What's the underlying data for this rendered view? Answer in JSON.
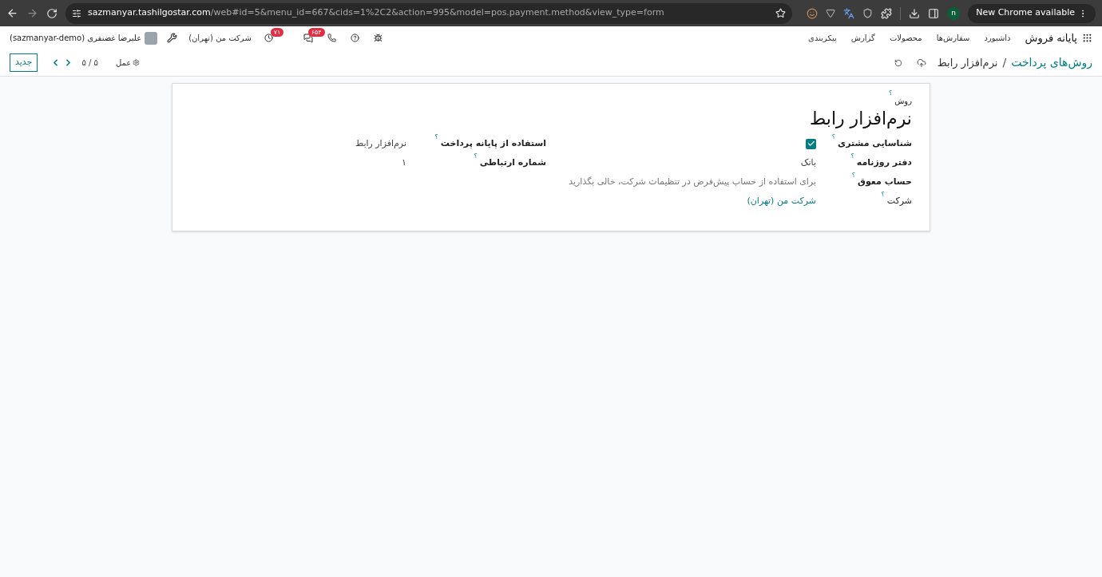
{
  "browser": {
    "url_host": "sazmanyar.tashilgostar.com",
    "url_path": "/web#id=5&menu_id=667&cids=1%2C2&action=995&model=pos.payment.method&view_type=form",
    "profile_initial": "n",
    "update_button": "New Chrome available"
  },
  "navbar": {
    "app_name": "پایانه فروش",
    "menu": [
      "داشبورد",
      "سفارش‌ها",
      "محصولات",
      "گزارش",
      "پیکربندی"
    ],
    "messages_count": "۶۵۴",
    "activities_count": "۷۱",
    "company": "شرکت من (تهران)",
    "user": "علیرضا غضنفری (sazmanyar-demo)"
  },
  "control_panel": {
    "breadcrumb_parent": "روش‌های پرداخت",
    "breadcrumb_separator": "/",
    "breadcrumb_current": "نرم‌افزار رابط",
    "action": "عمل",
    "pager": "۵ / ۵",
    "new_button": "جدید"
  },
  "form": {
    "name_label": "روش",
    "name_help": "؟",
    "name": "نرم‌افزار رابط",
    "right_fields": [
      {
        "label": "شناسایی مشتری",
        "help": "؟",
        "strong": true,
        "kind": "checkbox",
        "checked": true
      },
      {
        "label": "دفتر روزنامه",
        "help": "؟",
        "strong": true,
        "kind": "text",
        "value": "بانک"
      },
      {
        "label": "حساب معوق",
        "help": "؟",
        "strong": true,
        "kind": "placeholder",
        "placeholder": "برای استفاده از حساب پیش‌فرض در تنظیمات شرکت، خالی بگذارید"
      },
      {
        "label": "شرکت",
        "help": "؟",
        "strong": false,
        "kind": "link",
        "value": "شرکت من (تهران)"
      }
    ],
    "left_fields": [
      {
        "label": "استفاده از پایانه پرداخت",
        "help": "؟",
        "strong": true,
        "kind": "text",
        "value": "نرم‌افزار رابط"
      },
      {
        "label": "شماره ارتباطی",
        "help": "؟",
        "strong": true,
        "kind": "text",
        "value": "۱"
      }
    ]
  }
}
